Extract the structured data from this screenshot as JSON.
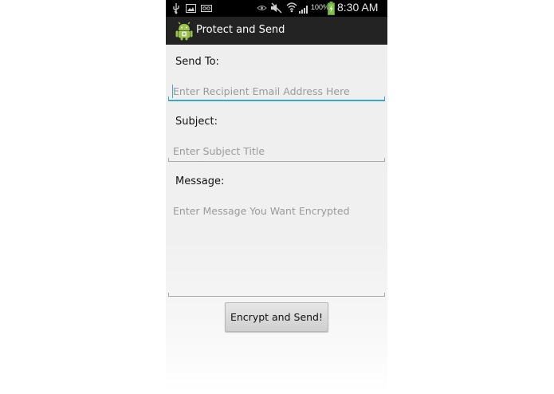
{
  "status_bar": {
    "battery_percent": "100%",
    "time": "8:30 AM",
    "icons": [
      "usb-icon",
      "gallery-icon",
      "voicemail-icon",
      "eye-icon",
      "mute-icon",
      "wifi-icon",
      "signal-icon",
      "battery-charging-icon"
    ]
  },
  "action_bar": {
    "title": "Protect and Send",
    "icon": "android-app-icon"
  },
  "form": {
    "send_to_label": "Send To:",
    "send_to_placeholder": "Enter Recipient Email Address Here",
    "subject_label": "Subject:",
    "subject_placeholder": "Enter Subject Title",
    "message_label": "Message:",
    "message_placeholder": "Enter Message You Want Encrypted",
    "submit_label": "Encrypt and Send!"
  },
  "colors": {
    "focus_accent": "#3aa7cf",
    "action_bar": "#232323",
    "status_bar": "#000000"
  }
}
